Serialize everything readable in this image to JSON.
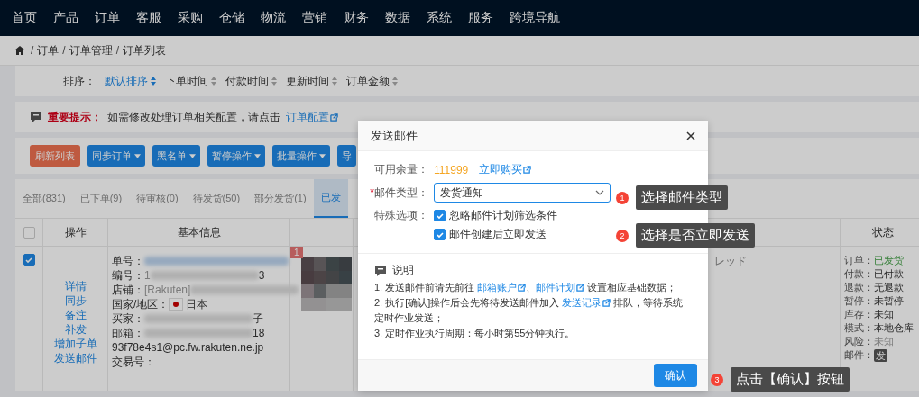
{
  "nav": {
    "items": [
      {
        "label": "首页"
      },
      {
        "label": "产品"
      },
      {
        "label": "订单"
      },
      {
        "label": "客服"
      },
      {
        "label": "采购"
      },
      {
        "label": "仓储"
      },
      {
        "label": "物流"
      },
      {
        "label": "营销"
      },
      {
        "label": "财务"
      },
      {
        "label": "数据"
      },
      {
        "label": "系统"
      },
      {
        "label": "服务"
      },
      {
        "label": "跨境导航"
      }
    ]
  },
  "breadcrumb": [
    {
      "sep": "/",
      "label": "订单"
    },
    {
      "sep": "/",
      "label": "订单管理"
    },
    {
      "sep": "/",
      "label": "订单列表"
    }
  ],
  "sort": {
    "label": "排序：",
    "options": [
      {
        "label": "默认排序",
        "selected": true
      },
      {
        "label": "下单时间",
        "selected": false
      },
      {
        "label": "付款时间",
        "selected": false
      },
      {
        "label": "更新时间",
        "selected": false
      },
      {
        "label": "订单金额",
        "selected": false
      }
    ]
  },
  "notice": {
    "title": "重要提示：",
    "text": "如需修改处理订单相关配置，请点击",
    "link": "订单配置"
  },
  "toolbar": [
    {
      "label": "刷新列表",
      "kind": "plain"
    },
    {
      "label": "同步订单",
      "kind": "dropdown"
    },
    {
      "label": "黑名单",
      "kind": "dropdown"
    },
    {
      "label": "暂停操作",
      "kind": "dropdown"
    },
    {
      "label": "批量操作",
      "kind": "dropdown"
    },
    {
      "label": "导",
      "kind": "plain-blue"
    }
  ],
  "tabs": [
    {
      "label": "全部(831)",
      "selected": false
    },
    {
      "label": "已下单(9)",
      "selected": false
    },
    {
      "label": "待审核(0)",
      "selected": false
    },
    {
      "label": "待发货(50)",
      "selected": false
    },
    {
      "label": "部分发货(1)",
      "selected": false
    },
    {
      "label": "已发",
      "selected": true
    }
  ],
  "table": {
    "all_checked": false,
    "columns": [
      "操作",
      "基本信息",
      "状态"
    ],
    "row": {
      "checked": true,
      "actions": [
        {
          "label": "详情"
        },
        {
          "label": "同步"
        },
        {
          "label": "备注"
        },
        {
          "label": "补发"
        },
        {
          "label": "增加子单"
        },
        {
          "label": "发送邮件"
        }
      ],
      "info": [
        {
          "label": "单号：",
          "kind": "redacted-link"
        },
        {
          "label": "编号：",
          "kind": "redacted",
          "value": "1",
          "tail": "3"
        },
        {
          "label": "店铺：",
          "kind": "redacted",
          "value": "[Rakuten]"
        },
        {
          "label": "国家/地区：",
          "kind": "flag",
          "value": "日本"
        },
        {
          "label": "买家：",
          "kind": "redacted",
          "tail": "子"
        },
        {
          "label": "邮箱：",
          "kind": "redacted",
          "tail": "18"
        },
        {
          "kind": "text",
          "value": "93f78e4s1@pc.fw.rakuten.ne.jp"
        },
        {
          "label": "交易号：",
          "kind": "text"
        }
      ],
      "image_badge": "1",
      "column_5": "レッド",
      "status": [
        {
          "label": "订单：",
          "value": "已发货",
          "kind": "success"
        },
        {
          "label": "付款：",
          "value": "已付款",
          "kind": "normal"
        },
        {
          "label": "退款：",
          "value": "无退款",
          "kind": "normal"
        },
        {
          "label": "暂停：",
          "value": "未暂停",
          "kind": "normal"
        },
        {
          "label": "库存：",
          "value": "未知",
          "kind": "normal"
        },
        {
          "label": "模式：",
          "value": "本地仓库",
          "kind": "normal"
        },
        {
          "label": "风险：",
          "value": "未知",
          "kind": "muted"
        },
        {
          "label": "邮件：",
          "value": "发",
          "kind": "badge"
        }
      ]
    }
  },
  "modal": {
    "title": "发送邮件",
    "balance_label": "可用余量：",
    "balance": "111999",
    "buy_link": "立即购买",
    "type_label": "邮件类型：",
    "required_mark": "*",
    "type_value": "发货通知",
    "options_label": "特殊选项：",
    "options": [
      {
        "label": "忽略邮件计划筛选条件",
        "checked": true
      },
      {
        "label": "邮件创建后立即发送",
        "checked": true
      }
    ],
    "note_title": "说明",
    "note_lines": [
      [
        {
          "text": "1. 发送邮件前请先前往 "
        },
        {
          "link": "邮箱账户"
        },
        {
          "text": "、"
        },
        {
          "link": "邮件计划"
        },
        {
          "text": " 设置相应基础数据；"
        }
      ],
      [
        {
          "text": "2. 执行[确认]操作后会先将待发送邮件加入 "
        },
        {
          "link": "发送记录"
        },
        {
          "text": " 排队，等待系统定时作业发送；"
        }
      ],
      [
        {
          "text": "3. 定时作业执行周期：每小时第55分钟执行。"
        }
      ]
    ],
    "confirm": "确认"
  },
  "annotations": [
    {
      "number": "1",
      "text": "选择邮件类型"
    },
    {
      "number": "2",
      "text": "选择是否立即发送"
    },
    {
      "number": "3",
      "text": "点击【确认】按钮"
    }
  ]
}
